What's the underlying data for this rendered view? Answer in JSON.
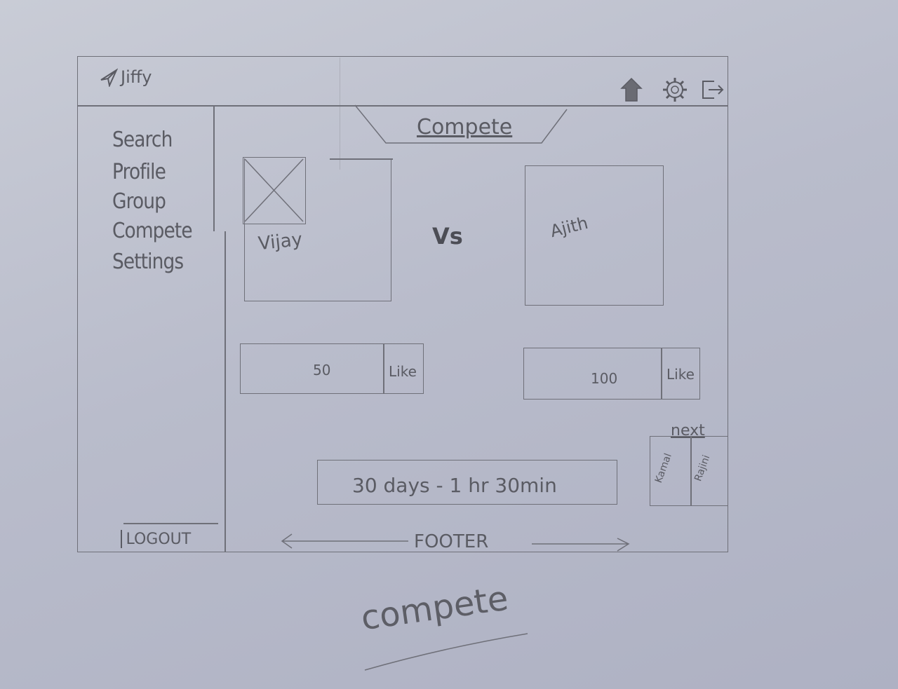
{
  "app": {
    "title": "Jiffy"
  },
  "header": {
    "icons": [
      "home-icon",
      "gear-icon",
      "logout-icon"
    ]
  },
  "sidebar": {
    "items": [
      {
        "label": "Search"
      },
      {
        "label": "Profile"
      },
      {
        "label": "Group"
      },
      {
        "label": "Compete"
      },
      {
        "label": "Settings"
      }
    ],
    "logout_label": "LOGOUT"
  },
  "main": {
    "tab_title": "Compete",
    "vs_label": "Vs",
    "left_contestant": {
      "name": "Vijay",
      "votes": "50",
      "like_label": "Like"
    },
    "right_contestant": {
      "name": "Ajith",
      "votes": "100",
      "like_label": "Like"
    },
    "timer": "30 days - 1 hr 30min",
    "next": {
      "label": "next",
      "items": [
        "Kamal",
        "Rajini"
      ]
    }
  },
  "footer": {
    "label": "FOOTER"
  },
  "caption": "compete",
  "colors": {
    "paper": "#c3c6d2",
    "pencil": "#6f7079"
  }
}
